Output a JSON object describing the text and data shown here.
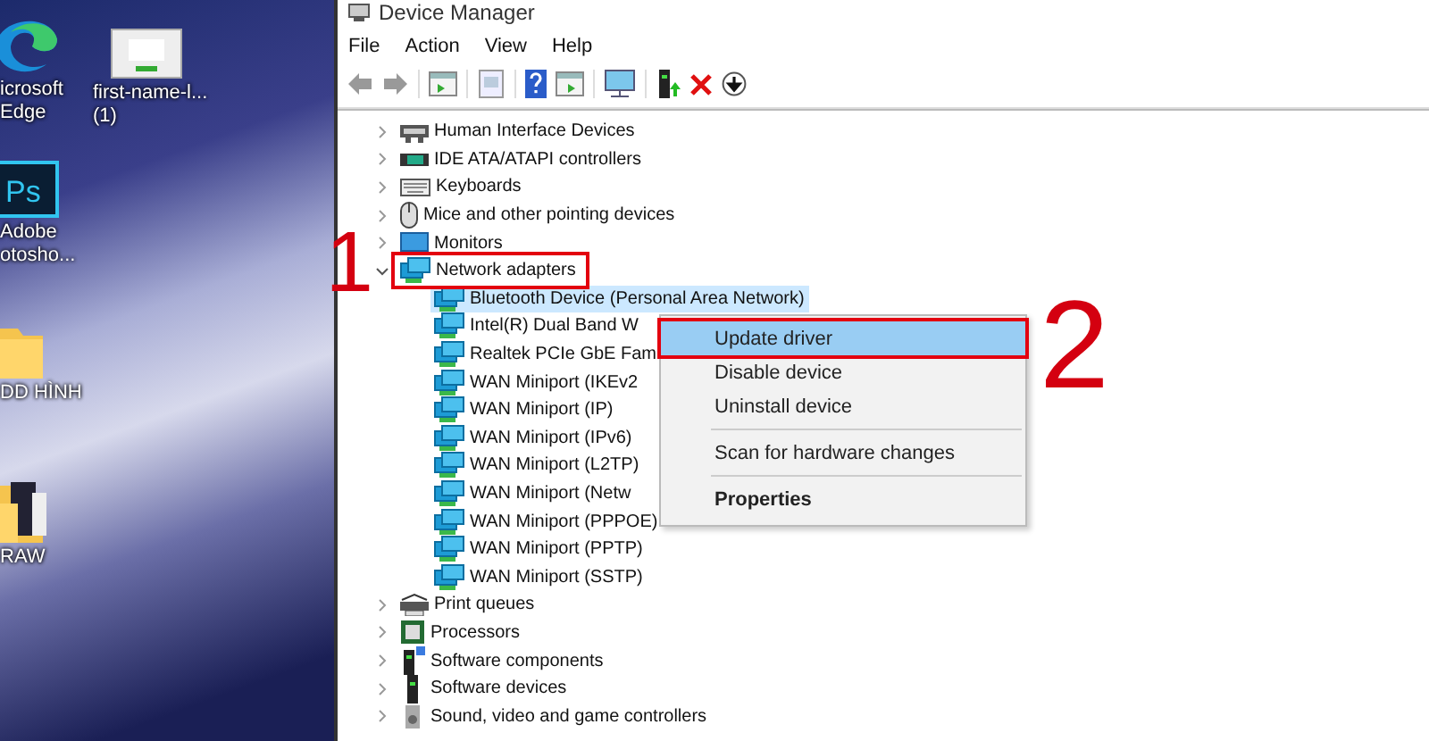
{
  "desktop": {
    "icons": [
      {
        "kind": "edge",
        "label_lines": [
          "icrosoft",
          "Edge"
        ]
      },
      {
        "kind": "file",
        "label_lines": [
          "first-name-l...",
          "(1)"
        ]
      },
      {
        "kind": "photoshop",
        "icon_text": "Ps",
        "label_lines": [
          "Adobe",
          "otosho..."
        ]
      },
      {
        "kind": "folder",
        "label_lines": [
          "DD HÌNH"
        ]
      },
      {
        "kind": "raw-folder",
        "label_lines": [
          "RAW"
        ]
      }
    ]
  },
  "window": {
    "title": "Device Manager",
    "menu": [
      "File",
      "Action",
      "View",
      "Help"
    ],
    "tree": [
      {
        "label": "Human Interface Devices",
        "kind": "hid",
        "expanded": false
      },
      {
        "label": "IDE ATA/ATAPI controllers",
        "kind": "ide",
        "expanded": false
      },
      {
        "label": "Keyboards",
        "kind": "keyboard",
        "expanded": false
      },
      {
        "label": "Mice and other pointing devices",
        "kind": "mouse",
        "expanded": false
      },
      {
        "label": "Monitors",
        "kind": "monitor",
        "expanded": false
      },
      {
        "label": "Network adapters",
        "kind": "network",
        "expanded": true,
        "callout": "1",
        "children": [
          {
            "label": "Bluetooth Device (Personal Area Network)",
            "selected": true
          },
          {
            "label": "Intel(R) Dual Band W",
            "selected": false
          },
          {
            "label": "Realtek PCIe GbE Fam",
            "selected": false
          },
          {
            "label": "WAN Miniport (IKEv2",
            "selected": false
          },
          {
            "label": "WAN Miniport (IP)",
            "selected": false
          },
          {
            "label": "WAN Miniport (IPv6)",
            "selected": false
          },
          {
            "label": "WAN Miniport (L2TP)",
            "selected": false
          },
          {
            "label": "WAN Miniport (Netw",
            "selected": false
          },
          {
            "label": "WAN Miniport (PPPOE)",
            "selected": false
          },
          {
            "label": "WAN Miniport (PPTP)",
            "selected": false
          },
          {
            "label": "WAN Miniport (SSTP)",
            "selected": false
          }
        ]
      },
      {
        "label": "Print queues",
        "kind": "printer",
        "expanded": false
      },
      {
        "label": "Processors",
        "kind": "processor",
        "expanded": false
      },
      {
        "label": "Software components",
        "kind": "component",
        "expanded": false
      },
      {
        "label": "Software devices",
        "kind": "software",
        "expanded": false
      },
      {
        "label": "Sound, video and game controllers",
        "kind": "sound",
        "expanded": false
      }
    ],
    "context_menu": [
      {
        "label": "Update driver",
        "selected": true,
        "default": false,
        "divider_before": false,
        "callout": "2"
      },
      {
        "label": "Disable device",
        "selected": false,
        "default": false,
        "divider_before": false
      },
      {
        "label": "Uninstall device",
        "selected": false,
        "default": false,
        "divider_before": false
      },
      {
        "label": "Scan for hardware changes",
        "selected": false,
        "default": false,
        "divider_before": true
      },
      {
        "label": "Properties",
        "selected": false,
        "default": true,
        "divider_before": true
      }
    ]
  }
}
